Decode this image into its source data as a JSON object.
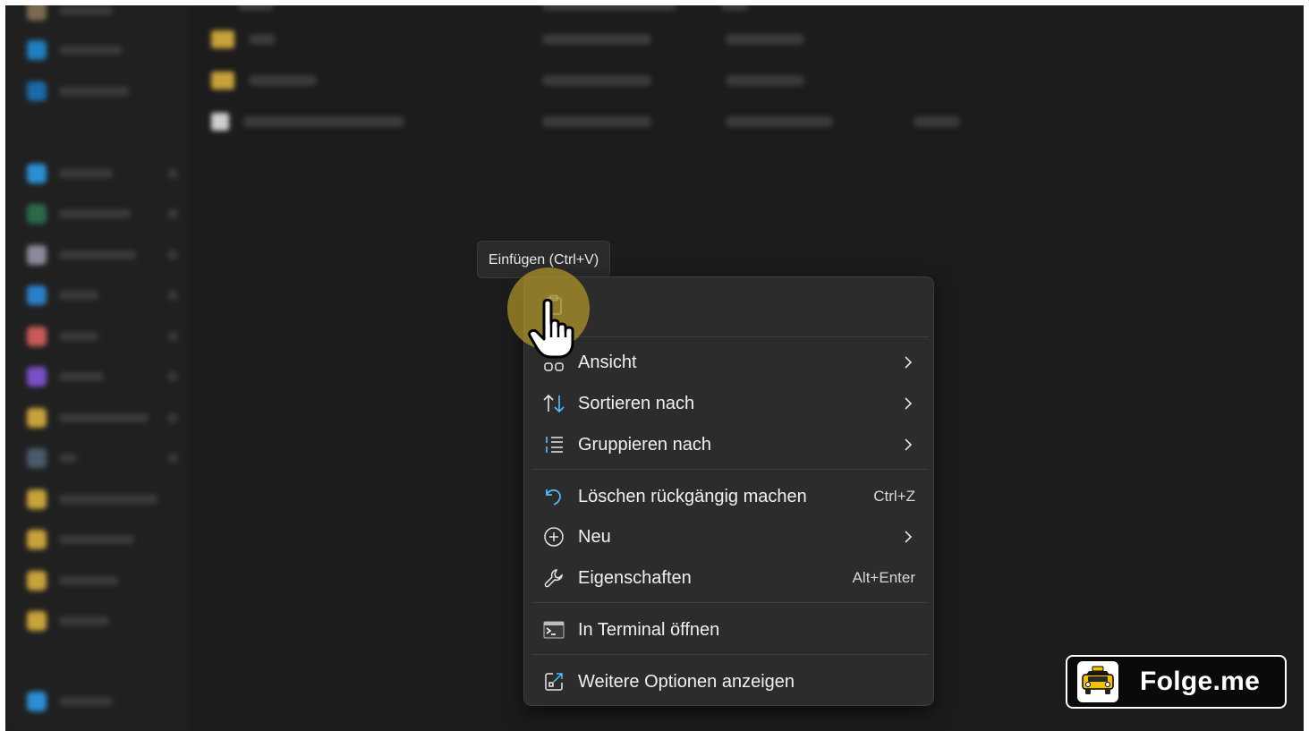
{
  "tooltip": {
    "text": "Einfügen (Ctrl+V)"
  },
  "quick_actions": [
    {
      "icon": "paste-icon"
    }
  ],
  "menu": {
    "items": [
      {
        "label": "Ansicht",
        "icon": "view-grid-icon",
        "submenu": true
      },
      {
        "label": "Sortieren nach",
        "icon": "sort-icon",
        "submenu": true
      },
      {
        "label": "Gruppieren nach",
        "icon": "group-by-icon",
        "submenu": true
      },
      {
        "label": "Löschen rückgängig machen",
        "icon": "undo-icon",
        "shortcut": "Ctrl+Z"
      },
      {
        "label": "Neu",
        "icon": "new-plus-icon",
        "submenu": true
      },
      {
        "label": "Eigenschaften",
        "icon": "wrench-icon",
        "shortcut": "Alt+Enter"
      },
      {
        "label": "In Terminal öffnen",
        "icon": "terminal-icon"
      },
      {
        "label": "Weitere Optionen anzeigen",
        "icon": "more-options-icon"
      }
    ]
  },
  "watermark": {
    "text": "Folge.me",
    "icon": "taxi-logo-icon"
  },
  "colors": {
    "background": "#1c1c1c",
    "menu_bg": "#2c2c2c",
    "accent_blue": "#4cc2ff",
    "highlight": "#c8aa28"
  }
}
